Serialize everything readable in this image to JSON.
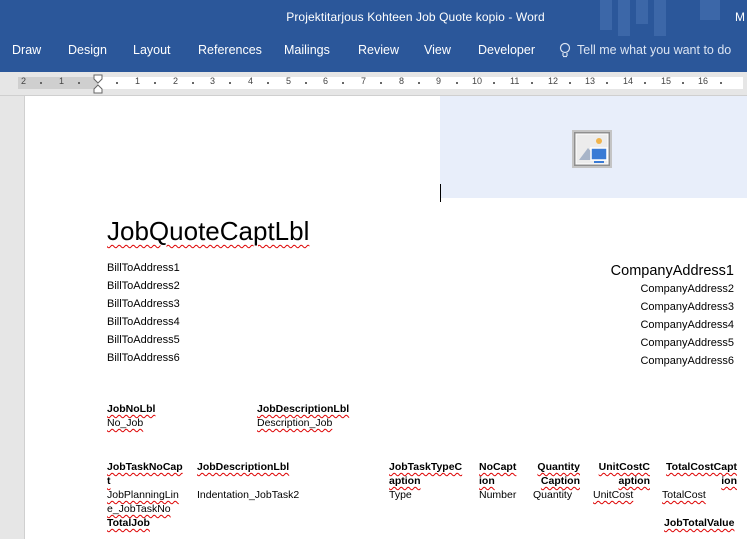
{
  "window": {
    "title": "Projektitarjous Kohteen Job Quote kopio  -  Word",
    "user_initial": "M"
  },
  "ribbon": {
    "tabs": [
      "Draw",
      "Design",
      "Layout",
      "References",
      "Mailings",
      "Review",
      "View",
      "Developer"
    ],
    "tell_me": "Tell me what you want to do"
  },
  "ruler": {
    "numbers": [
      "2",
      "1",
      "1",
      "2",
      "3",
      "4",
      "5",
      "6",
      "7",
      "8",
      "9",
      "10",
      "11",
      "12",
      "13",
      "14",
      "15",
      "16"
    ]
  },
  "document": {
    "title": "JobQuoteCaptLbl",
    "bill_to": [
      "BillToAddress1",
      "BillToAddress2",
      "BillToAddress3",
      "BillToAddress4",
      "BillToAddress5",
      "BillToAddress6"
    ],
    "company": [
      "CompanyAddress1",
      "CompanyAddress2",
      "CompanyAddress3",
      "CompanyAddress4",
      "CompanyAddress5",
      "CompanyAddress6"
    ],
    "job_header": {
      "no_lbl": "JobNoLbl",
      "no_value": "No_Job",
      "desc_lbl": "JobDescriptionLbl",
      "desc_value": "Description_Job"
    },
    "table": {
      "headers": {
        "task_no": [
          "JobTaskNoCap",
          "t"
        ],
        "desc": "JobDescriptionLbl",
        "type": [
          "JobTaskTypeC",
          "aption"
        ],
        "no": [
          "NoCapt",
          "ion"
        ],
        "qty": [
          "Quantity",
          "Caption"
        ],
        "unit_cost": [
          "UnitCostC",
          "aption"
        ],
        "total_cost": [
          "TotalCostCapt",
          "ion"
        ]
      },
      "row": {
        "task_no": [
          "JobPlanningLin",
          "e_JobTaskNo"
        ],
        "desc": "Indentation_JobTask2",
        "type": "Type",
        "no": "Number",
        "qty": "Quantity",
        "unit_cost": "UnitCost",
        "total_cost": "TotalCost"
      },
      "total_label": "TotalJob",
      "total_value": "JobTotalValue"
    }
  }
}
